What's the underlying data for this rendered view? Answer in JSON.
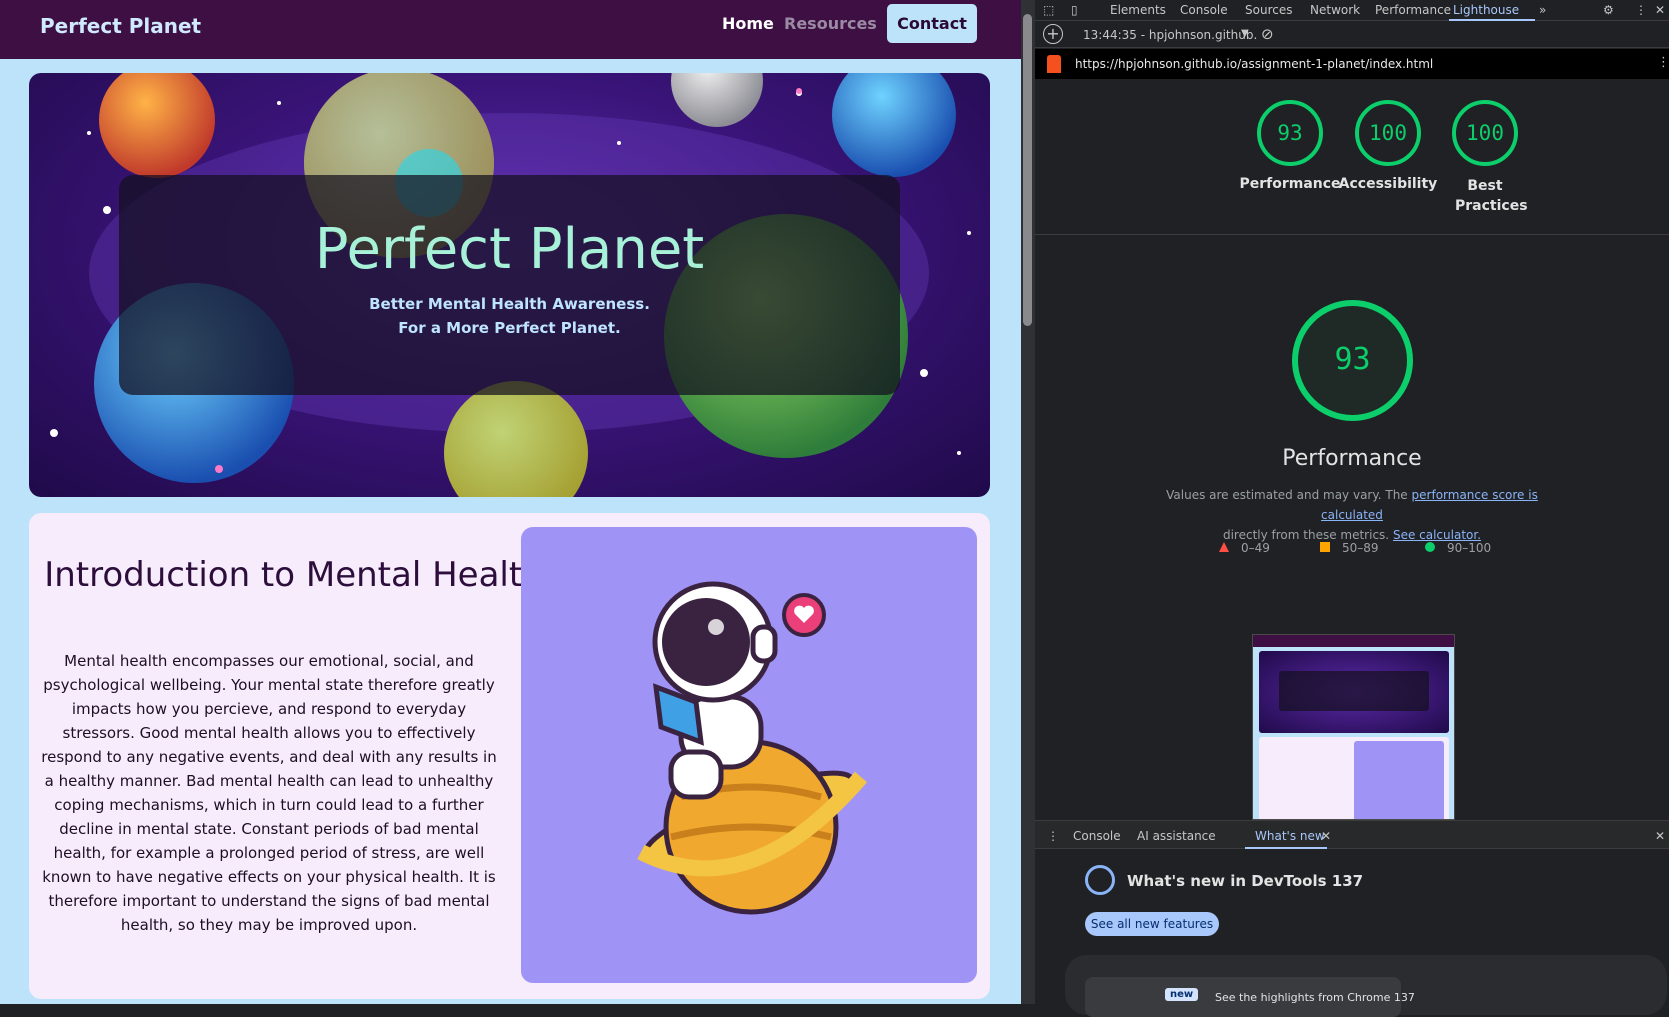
{
  "site": {
    "brand": "Perfect Planet",
    "nav": {
      "home": "Home",
      "resources": "Resources",
      "contact": "Contact"
    },
    "hero": {
      "title": "Perfect Planet",
      "subtitle_line1": "Better Mental Health Awareness.",
      "subtitle_line2": "For a More Perfect Planet."
    },
    "intro": {
      "title": "Introduction to Mental Health",
      "body": "Mental health encompasses our emotional, social, and psychological wellbeing. Your mental state therefore greatly impacts how you percieve, and respond to everyday stressors. Good mental health allows you to effectively respond to any negative events, and deal with any results in a healthy manner. Bad mental health can lead to unhealthy coping mechanisms, which in turn could lead to a further decline in mental state. Constant periods of bad mental health, for example a prolonged period of stress, are well known to have negative effects on your physical health. It is therefore important to understand the signs of bad mental health, so they may be improved upon."
    },
    "colors": {
      "nav_bg": "#3d0f43",
      "page_bg": "#bde3fb",
      "intro_bg": "#f6ecfb",
      "art_bg": "#a093f6",
      "hero_title": "#a7f1d8"
    }
  },
  "devtools": {
    "tabs": [
      "Elements",
      "Console",
      "Sources",
      "Network",
      "Performance",
      "Lighthouse"
    ],
    "run_label": "13:44:35 - hpjohnson.github.",
    "url": "https://hpjohnson.github.io/assignment-1-planet/index.html",
    "scores": [
      {
        "value": "93",
        "label": "Performance"
      },
      {
        "value": "100",
        "label": "Accessibility"
      },
      {
        "value": "100",
        "label": "Best Practices"
      }
    ],
    "perf": {
      "score": "93",
      "title": "Performance",
      "desc_prefix": "Values are estimated and may vary. The",
      "desc_link1": "performance score is calculated",
      "desc_mid": "directly from these metrics.",
      "desc_link2": "See calculator."
    },
    "legend": [
      {
        "range": "0–49",
        "color": "#ff4e42"
      },
      {
        "range": "50–89",
        "color": "#ffa400"
      },
      {
        "range": "90–100",
        "color": "#0cce6b"
      }
    ],
    "drawer_tabs": [
      "Console",
      "AI assistance",
      "What's new"
    ],
    "whats_new": {
      "title": "What's new in DevTools 137",
      "button": "See all new features",
      "card_badge": "new",
      "card_text": "See the highlights from Chrome 137"
    },
    "accent": "#a8c7fa",
    "score_green": "#0cce6b"
  }
}
